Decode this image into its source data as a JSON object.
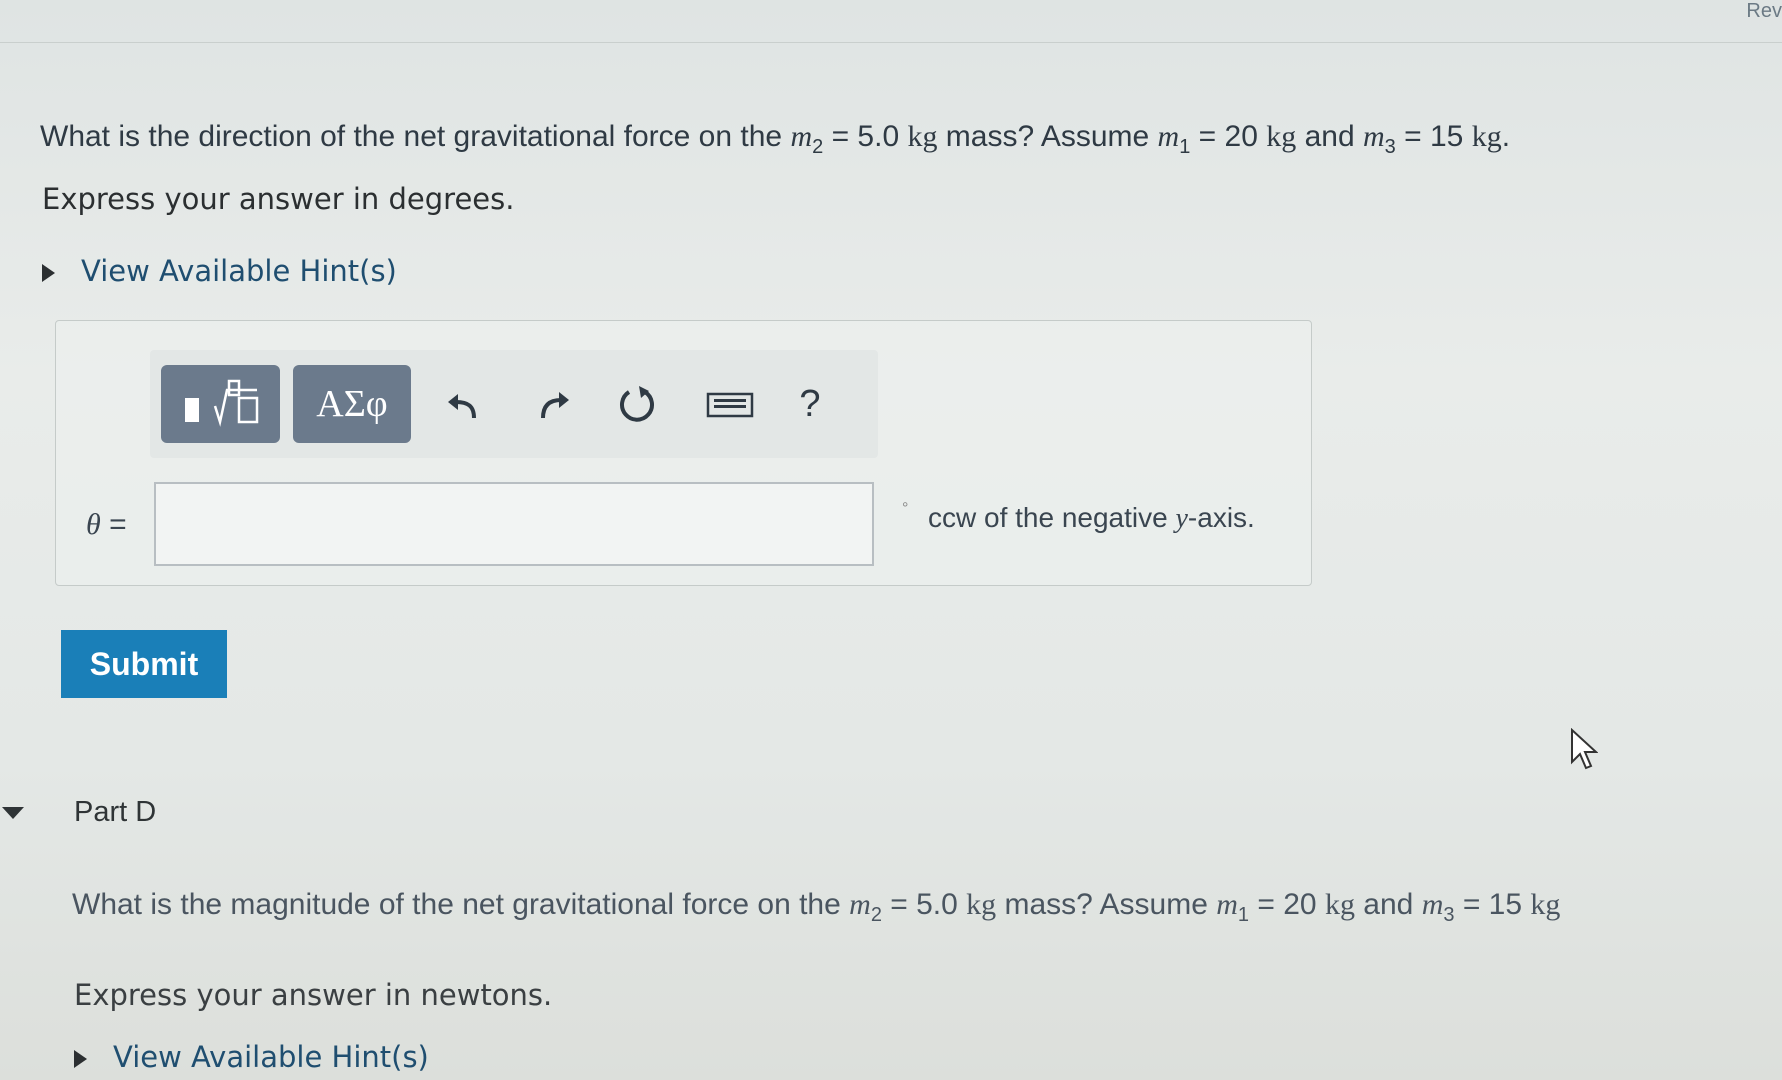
{
  "partC": {
    "question": {
      "prefix": "What is the direction of the net gravitational force on the ",
      "m2_symbol": "m",
      "m2_sub": "2",
      "m2_eq": " = 5.0 ",
      "m2_unit": "kg",
      "mid": " mass? Assume ",
      "m1_symbol": "m",
      "m1_sub": "1",
      "m1_eq": " = 20 ",
      "m1_unit": "kg",
      "and": " and ",
      "m3_symbol": "m",
      "m3_sub": "3",
      "m3_eq": " = 15 ",
      "m3_unit": "kg",
      "end": "."
    },
    "instruction": "Express your answer in degrees.",
    "hint_label": "View Available Hint(s)",
    "toolbar": {
      "templates_label": "√□",
      "greek_label": "ΑΣφ",
      "undo_icon": "undo-icon",
      "redo_icon": "redo-icon",
      "reset_icon": "reset-icon",
      "keyboard_icon": "keyboard-icon",
      "help_label": "?"
    },
    "answer": {
      "variable": "θ",
      "equals": " =",
      "value": "",
      "degree_mark": "°",
      "units_prefix": "ccw of the negative ",
      "units_var": "y",
      "units_suffix": "-axis."
    },
    "submit_label": "Submit"
  },
  "partD": {
    "title": "Part D",
    "question": {
      "prefix": "What is the magnitude of the net gravitational force on the ",
      "m2_symbol": "m",
      "m2_sub": "2",
      "m2_eq": " = 5.0 ",
      "m2_unit": "kg",
      "mid": " mass? Assume ",
      "m1_symbol": "m",
      "m1_sub": "1",
      "m1_eq": " = 20 ",
      "m1_unit": "kg",
      "and": " and ",
      "m3_symbol": "m",
      "m3_sub": "3",
      "m3_eq": " = 15 ",
      "m3_unit": "kg"
    },
    "instruction": "Express your answer in newtons.",
    "hint_label": "View Available Hint(s)"
  },
  "header": {
    "corner_text": "Rev"
  },
  "colors": {
    "submit": "#1a7fb8",
    "toolbar_button": "#6b7a8c",
    "link": "#1f4e70"
  }
}
